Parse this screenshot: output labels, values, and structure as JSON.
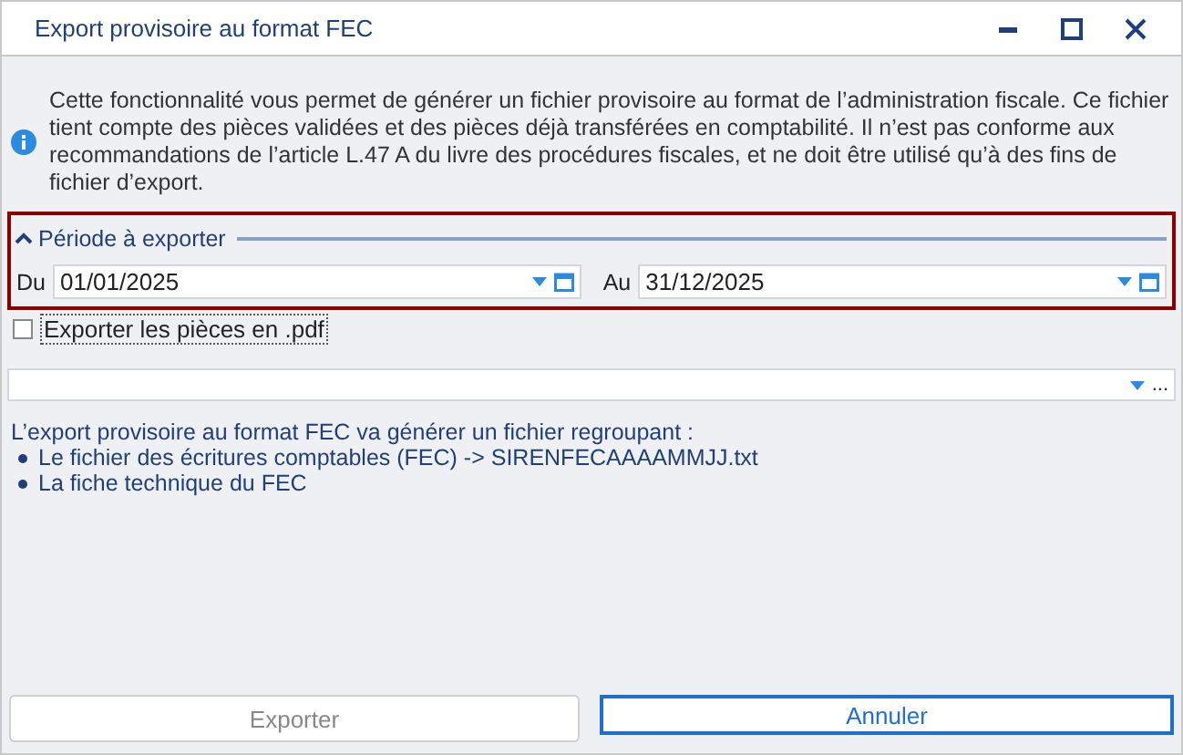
{
  "window": {
    "title": "Export provisoire au format FEC"
  },
  "info": "Cette fonctionnalité vous permet de générer un fichier provisoire au format de l’administration fiscale. Ce fichier tient compte des pièces validées et des pièces déjà transférées en comptabilité. Il n’est pas conforme aux recommandations de l’article L.47 A du livre des procédures fiscales, et ne doit être utilisé qu’à des fins de fichier d’export.",
  "period": {
    "title": "Période à exporter",
    "expanded": true,
    "from": {
      "label": "Du",
      "value": "01/01/2025"
    },
    "to": {
      "label": "Au",
      "value": "31/12/2025"
    }
  },
  "pdf_option": {
    "label": "Exporter les pièces en .pdf",
    "checked": false
  },
  "path_field": {
    "button": "..."
  },
  "summary": {
    "intro": "L’export provisoire au format FEC va générer un fichier regroupant :",
    "items": [
      "Le fichier des écritures comptables (FEC) -> SIRENFECAAAAMMJJ.txt",
      "La fiche technique du FEC"
    ]
  },
  "buttons": [
    {
      "label": "Exporter",
      "disabled": true,
      "focused": false
    },
    {
      "label": "Annuler",
      "disabled": false,
      "focused": true
    }
  ]
}
